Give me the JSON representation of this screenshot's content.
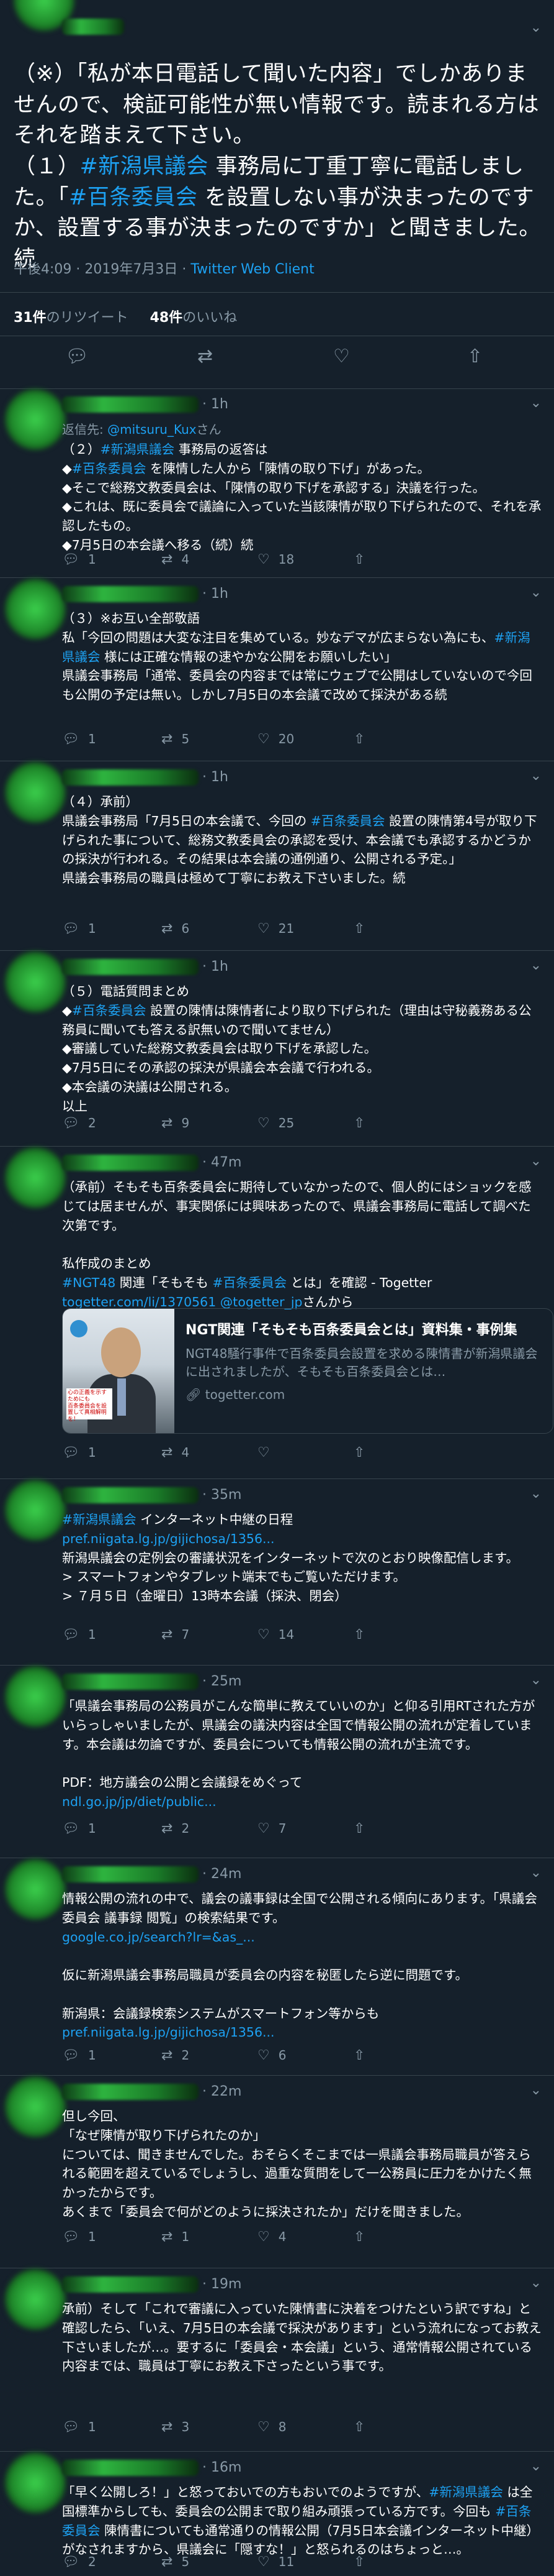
{
  "main": {
    "body": "（※）「私が本日電話して聞いた内容」でしかありませんので、検証可能性が無い情報です。読まれる方はそれを踏まえて下さい。\n（１）#新潟県議会 事務局に丁重丁寧に電話しました。「#百条委員会 を設置しない事が決まったのですか、設置する事が決まったのですか」と聞きました。続",
    "time": "午後4:09 · 2019年7月3日",
    "client": "Twitter Web Client",
    "retweets_count": "31件",
    "retweets_label": "のリツイート",
    "likes_count": "48件",
    "likes_label": "のいいね"
  },
  "icons": {
    "reply": "comment-icon",
    "retweet": "retweet-icon",
    "like": "heart-icon",
    "share": "share-icon",
    "more": "chevron-down-icon"
  },
  "replies": [
    {
      "time": "1h",
      "reply_to_prefix": "返信先: ",
      "reply_to_handle": "@mitsuru_Kux",
      "reply_to_suffix": "さん",
      "body": "（２）#新潟県議会 事務局の返答は\n◆#百条委員会 を陳情した人から「陳情の取り下げ」があった。\n◆そこで総務文教委員会は、「陳情の取り下げを承認する」決議を行った。\n◆これは、既に委員会で議論に入っていた当該陳情が取り下げられたので、それを承認したもの。\n◆7月5日の本会議へ移る（続）続",
      "replies": "1",
      "retweets": "4",
      "likes": "18"
    },
    {
      "time": "1h",
      "body": "（３）※お互い全部敬語\n私「今回の問題は大変な注目を集めている。妙なデマが広まらない為にも、#新潟県議会 様には正確な情報の速やかな公開をお願いしたい」\n県議会事務局「通常、委員会の内容までは常にウェブで公開はしていないので今回も公開の予定は無い。しかし7月5日の本会議で改めて採決がある続",
      "replies": "1",
      "retweets": "5",
      "likes": "20"
    },
    {
      "time": "1h",
      "body": "（４）承前）\n県議会事務局「7月5日の本会議で、今回の #百条委員会 設置の陳情第4号が取り下げられた事について、総務文教委員会の承認を受け、本会議でも承認するかどうかの採決が行われる。その結果は本会議の通例通り、公開される予定。」\n県議会事務局の職員は極めて丁寧にお教え下さいました。続",
      "replies": "1",
      "retweets": "6",
      "likes": "21"
    },
    {
      "time": "1h",
      "body": "（５）電話質問まとめ\n◆#百条委員会 設置の陳情は陳情者により取り下げられた（理由は守秘義務ある公務員に聞いても答える訳無いので聞いてません）\n◆審議していた総務文教委員会は取り下げを承認した。\n◆7月5日にその承認の採決が県議会本会議で行われる。\n◆本会議の決議は公開される。\n以上",
      "replies": "2",
      "retweets": "9",
      "likes": "25"
    },
    {
      "time": "47m",
      "body": "（承前）そもそも百条委員会に期待していなかったので、個人的にはショックを感じては居ませんが、事実関係には興味あったので、県議会事務局に電話して調べた次第です。\n\n私作成のまとめ\n#NGT48 関連「そもそも #百条委員会 とは」を確認 - Togetter\ntogetter.com/li/1370561 @togetter_jpさんから",
      "card": {
        "title": "NGT関連「そもそも百条委員会とは」資料集・事例集",
        "desc": "NGT48騒行事件で百条委員会設置を求める陳情書が新潟県議会に出されましたが、そもそも百条委員会とは…",
        "domain": "togetter.com",
        "thumb_text": "心の正義を示すためにも\n百条委員会を設置して真相解明を！"
      },
      "replies": "1",
      "retweets": "4",
      "likes": ""
    },
    {
      "time": "35m",
      "body": "#新潟県議会 インターネット中継の日程\npref.niigata.lg.jp/gijichosa/1356...\n新潟県議会の定例会の審議状況をインターネットで次のとおり映像配信します。\n> スマートフォンやタブレット端末でもご覧いただけます。\n> ７月５日（金曜日）13時本会議（採決、閉会）",
      "replies": "1",
      "retweets": "7",
      "likes": "14"
    },
    {
      "time": "25m",
      "body": "「県議会事務局の公務員がこんな簡単に教えていいのか」と仰る引用RTされた方がいらっしゃいましたが、県議会の議決内容は全国で情報公開の流れが定着しています。本会議は勿論ですが、委員会についても情報公開の流れが主流です。\n\nPDF：地方議会の公開と会議録をめぐって\nndl.go.jp/jp/diet/public...",
      "replies": "1",
      "retweets": "2",
      "likes": "7"
    },
    {
      "time": "24m",
      "body": "情報公開の流れの中で、議会の議事録は全国で公開される傾向にあります。「県議会 委員会 議事録 閲覧」の検索結果です。\ngoogle.co.jp/search?lr=&as_...\n\n仮に新潟県議会事務局職員が委員会の内容を秘匿したら逆に問題です。\n\n新潟県：会議録検索システムがスマートフォン等からも\npref.niigata.lg.jp/gijichosa/1356...",
      "replies": "1",
      "retweets": "2",
      "likes": "6"
    },
    {
      "time": "22m",
      "body": "但し今回、\n「なぜ陳情が取り下げられたのか」\nについては、聞きませんでした。おそらくそこまでは一県議会事務局職員が答えられる範囲を超えているでしょうし、過重な質問をして一公務員に圧力をかけたく無かったからです。\nあくまで「委員会で何がどのように採決されたか」だけを聞きました。",
      "replies": "1",
      "retweets": "1",
      "likes": "4"
    },
    {
      "time": "19m",
      "body": "承前）そして「これで審議に入っていた陳情書に決着をつけたという訳ですね」と確認したら、「いえ、7月5日の本会議で採決があります」という流れになってお教え下さいましたが…。要するに「委員会・本会議」という、通常情報公開されている内容までは、職員は丁寧にお教え下さったという事です。",
      "replies": "1",
      "retweets": "3",
      "likes": "8"
    },
    {
      "time": "16m",
      "body": "「早く公開しろ！」と怒っておいでの方もおいでのようですが、#新潟県議会 は全国標準からしても、委員会の公開まで取り組み頑張っている方です。今回も #百条委員会 陳情書についても通常通りの情報公開（7月5日本会議インターネット中継）がなされますから、県議会に「隠すな！」と怒られるのはちょっと…。",
      "replies": "2",
      "retweets": "5",
      "likes": "11"
    }
  ]
}
